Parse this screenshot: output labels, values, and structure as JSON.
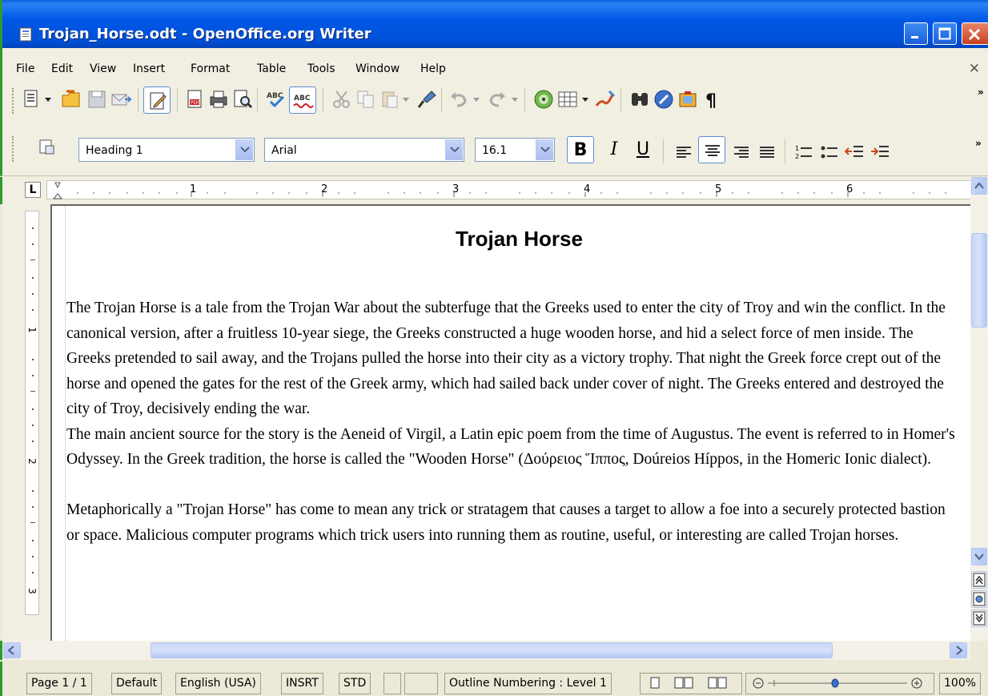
{
  "window": {
    "title": "Trojan_Horse.odt - OpenOffice.org Writer"
  },
  "menu": [
    "File",
    "Edit",
    "View",
    "Insert",
    "Format",
    "Table",
    "Tools",
    "Window",
    "Help"
  ],
  "formatting": {
    "style": "Heading 1",
    "font": "Arial",
    "size": "16.1",
    "bold": "B",
    "italic": "I",
    "underline": "U"
  },
  "ruler_numbers": [
    "1",
    "2",
    "3",
    "4",
    "5",
    "6"
  ],
  "vruler_numbers": [
    "1",
    "2",
    "3"
  ],
  "document": {
    "title": "Trojan Horse",
    "body": "The Trojan Horse is a tale from the Trojan War about the subterfuge that the Greeks used to enter the city of Troy and win the conflict. In the canonical version, after a fruitless 10-year siege, the Greeks constructed a huge wooden horse, and hid a select force of men inside. The Greeks pretended to sail away, and the Trojans pulled the horse into their city as a victory trophy. That night the Greek force crept out of the horse and opened the gates for the rest of the Greek army, which had sailed back under cover of night. The Greeks entered and destroyed the city of Troy, decisively ending the war.\nThe main ancient source for the story is the Aeneid of Virgil, a Latin epic poem from the time of Augustus. The event is referred to in Homer's Odyssey. In the Greek tradition, the horse is called the \"Wooden Horse\" (Δούρειος Ἵππος, Doúreios Híppos, in the Homeric Ionic dialect).\n\nMetaphorically a \"Trojan Horse\" has come to mean any trick or stratagem that causes a target to allow a foe into a securely protected bastion or space. Malicious computer programs which trick users into running them as routine, useful, or interesting are called Trojan horses."
  },
  "status": {
    "page": "Page 1 / 1",
    "style": "Default",
    "language": "English (USA)",
    "insert": "INSRT",
    "selection": "STD",
    "outline": "Outline Numbering : Level 1",
    "zoom": "100%"
  },
  "icons": {
    "toolbar1": [
      "new-document-icon",
      "open-folder-icon",
      "save-icon",
      "email-icon",
      "edit-file-icon",
      "export-pdf-icon",
      "print-icon",
      "page-preview-icon",
      "spellcheck-icon",
      "autospellcheck-icon",
      "cut-icon",
      "copy-icon",
      "paste-icon",
      "clone-format-icon",
      "undo-icon",
      "redo-icon",
      "navigator-icon",
      "table-icon",
      "draw-icon",
      "find-replace-icon",
      "gallery-icon",
      "data-sources-icon",
      "pilcrow-icon"
    ]
  }
}
